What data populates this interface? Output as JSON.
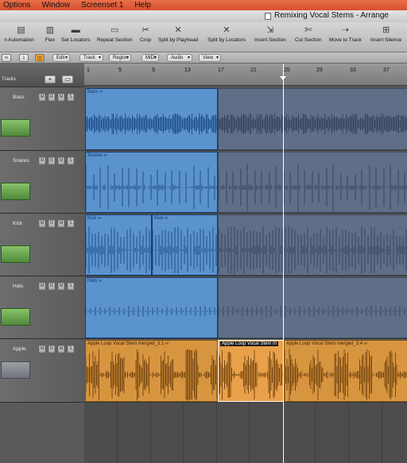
{
  "menubar": {
    "items": [
      "Options",
      "Window",
      "Screenset 1",
      "Help"
    ]
  },
  "window": {
    "title": "Remixing Vocal Stems - Arrange"
  },
  "toolbar": {
    "tools": [
      {
        "label": "n",
        "icon": ""
      },
      {
        "label": "Automation",
        "icon": "automation-icon"
      },
      {
        "label": "Flex",
        "icon": "flex-icon"
      },
      {
        "label": "Set Locators",
        "icon": "set-locators-icon"
      },
      {
        "label": "Repeat Section",
        "icon": "repeat-section-icon"
      },
      {
        "label": "Crop",
        "icon": "crop-icon"
      },
      {
        "label": "Split by Playhead",
        "icon": "split-playhead-icon"
      },
      {
        "label": "Split by Locators",
        "icon": "split-locators-icon"
      },
      {
        "label": "Insert Section",
        "icon": "insert-section-icon"
      },
      {
        "label": "Cut Section",
        "icon": "cut-section-icon"
      },
      {
        "label": "Move to Track",
        "icon": "move-to-track-icon"
      },
      {
        "label": "Insert Silence",
        "icon": "insert-silence-icon"
      }
    ]
  },
  "localbar": {
    "menus": [
      "Edit",
      "Track",
      "Region",
      "MIDI",
      "Audio",
      "View"
    ]
  },
  "tracks_header": {
    "label": "Tracks",
    "add": "+",
    "mute": "M",
    "record": "R",
    "solo": "S"
  },
  "ruler": {
    "bars": [
      "1",
      "5",
      "9",
      "13",
      "17",
      "21",
      "25",
      "29",
      "33",
      "37"
    ]
  },
  "tracks": [
    {
      "name": "Bass",
      "regions": [
        {
          "label": "Bass ∞"
        },
        {
          "label": ""
        }
      ]
    },
    {
      "name": "Snares",
      "regions": [
        {
          "label": "Snares ∞"
        },
        {
          "label": ""
        }
      ]
    },
    {
      "name": "Kick",
      "regions": [
        {
          "label": "Kick ∞"
        },
        {
          "label": "Kick ∞"
        },
        {
          "label": ""
        }
      ]
    },
    {
      "name": "Hats",
      "regions": [
        {
          "label": "Hats ∞"
        },
        {
          "label": ""
        }
      ]
    },
    {
      "name": "Apple",
      "regions": [
        {
          "label": "Apple Loop Vocal Stem merged_3.1 ∞"
        },
        {
          "label": "Apple Loop Vocal Stem m"
        },
        {
          "label": "Apple Loop Vocal Stem merged_3.4 ∞"
        }
      ]
    }
  ],
  "colors": {
    "selected_region": "#5b93cf",
    "dim_region": "#5f6f87",
    "audio_region": "#d89540",
    "menubar": "#e06040"
  }
}
